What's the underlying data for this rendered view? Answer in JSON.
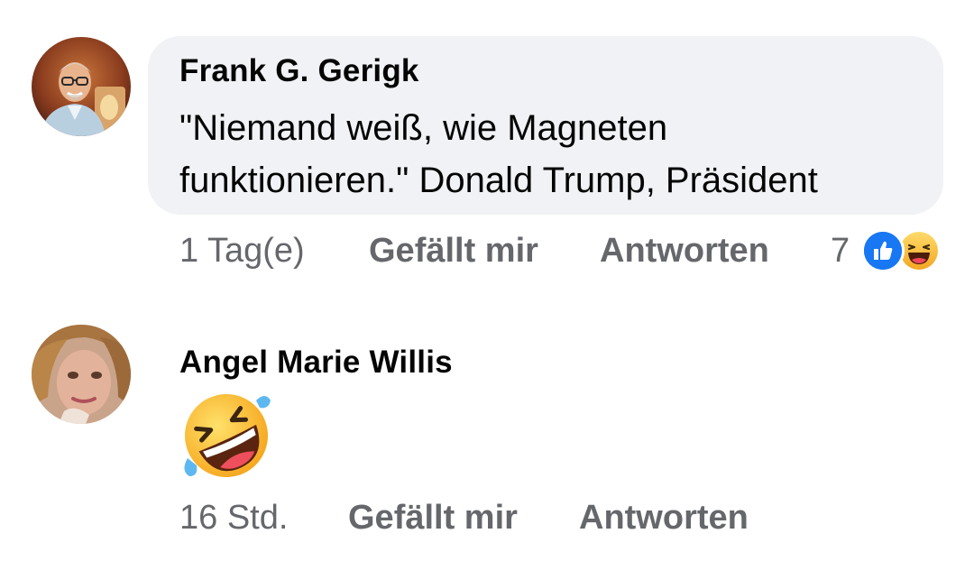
{
  "comments": [
    {
      "author": "Frank G. Gerigk",
      "text_lines": [
        "\"Niemand weiß, wie Magneten",
        "funktionieren.\" Donald Trump, Präsident"
      ],
      "time": "1 Tag(e)",
      "like_label": "Gefällt mir",
      "reply_label": "Antworten",
      "reactions": {
        "count": "7",
        "icons": [
          "like-reaction-icon",
          "haha-reaction-icon"
        ]
      },
      "avatar_icon": "profile-photo-frank"
    },
    {
      "author": "Angel Marie Willis",
      "emoji": "rolling-on-the-floor-laughing-icon",
      "time": "16 Std.",
      "like_label": "Gefällt mir",
      "reply_label": "Antworten",
      "avatar_icon": "profile-photo-angel"
    }
  ],
  "colors": {
    "bubble_bg": "#f0f2f5",
    "text_primary": "#050505",
    "text_secondary": "#65676b",
    "like_blue": "#1877f2"
  }
}
